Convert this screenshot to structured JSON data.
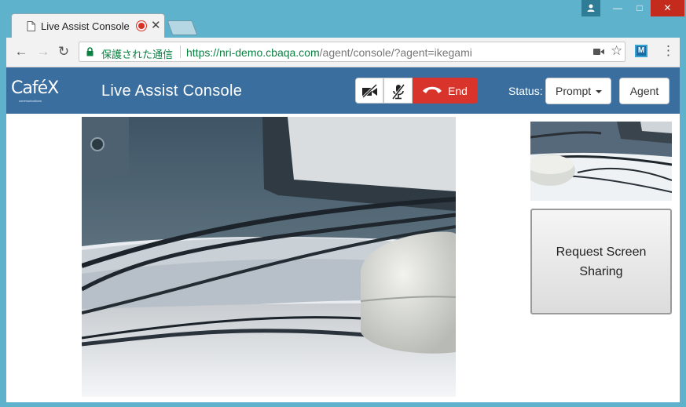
{
  "browser": {
    "tab_title": "Live Assist Console",
    "secure_label": "保護された通信",
    "url_main": "https://nri-demo.cbaqa.com",
    "url_path": "/agent/console/?agent=ikegami",
    "extension_label": "M"
  },
  "app": {
    "logo_text": "CaféX",
    "logo_subtext": "communications",
    "title": "Live Assist Console",
    "end_label": "End",
    "status_label": "Status:",
    "status_value": "Prompt",
    "agent_label": "Agent",
    "share_button_label": "Request Screen Sharing"
  },
  "colors": {
    "navbar": "#3a6e9e",
    "end_button": "#d9342b",
    "secure_green": "#0b8043"
  }
}
